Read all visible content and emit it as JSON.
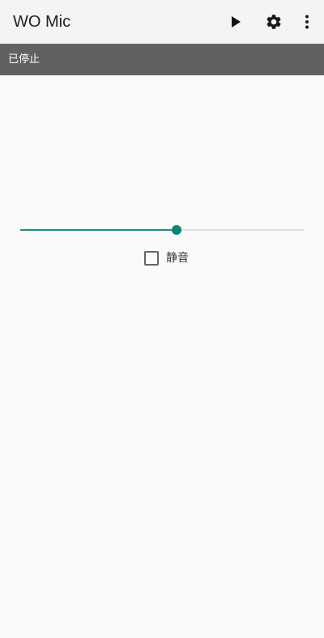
{
  "app": {
    "title": "WO Mic"
  },
  "toolbar": {
    "actions": [
      {
        "icon": "play-icon"
      },
      {
        "icon": "gear-icon"
      },
      {
        "icon": "more-vert-icon"
      }
    ]
  },
  "status": {
    "text": "已停止",
    "background": "#616161"
  },
  "volume_slider": {
    "value_percent": 55,
    "active_color": "#1e8c80",
    "inactive_color": "#dcdcdc"
  },
  "mute": {
    "label": "静音",
    "checked": false
  },
  "colors": {
    "appbar": "#f4f4f4",
    "background": "#fafafa",
    "accent": "#0f8275"
  }
}
